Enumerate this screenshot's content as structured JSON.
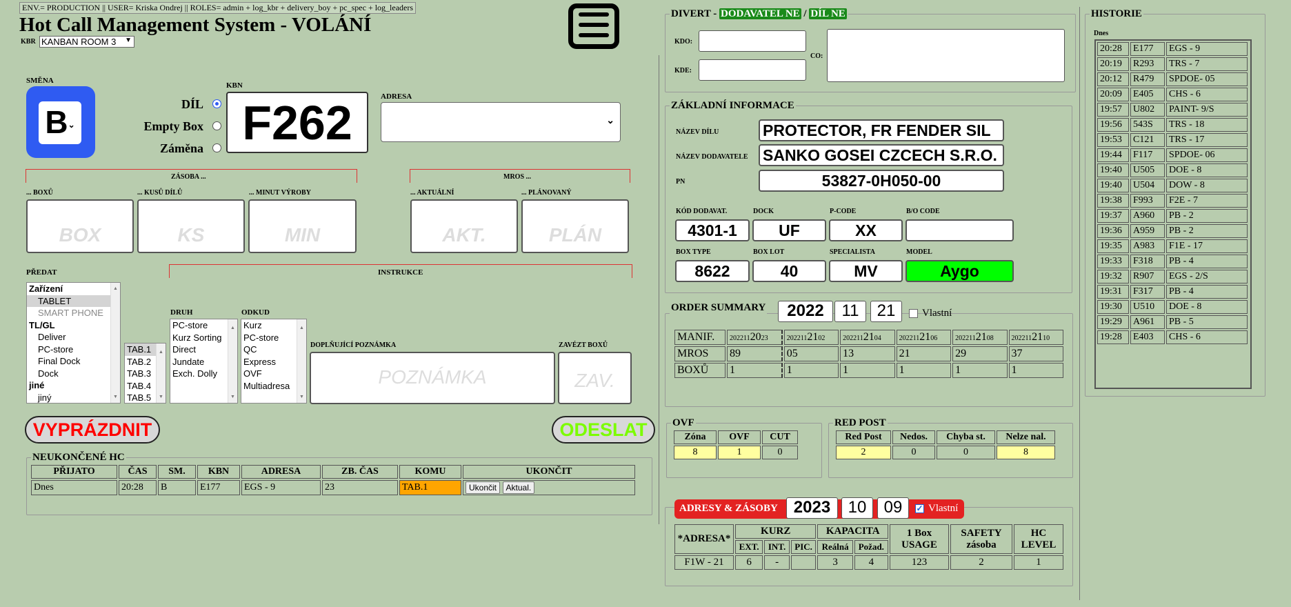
{
  "env_bar": "ENV.= PRODUCTION || USER= Kriska Ondrej || ROLES= admin + log_kbr + delivery_boy + pc_spec + log_leaders",
  "title": "Hot Call Management System - VOLÁNÍ",
  "kbr": {
    "label": "KBR",
    "selected": "KANBAN ROOM 3"
  },
  "smena": {
    "label": "SMĚNA",
    "value": "B"
  },
  "radio": {
    "dil": "DÍL",
    "empty_box": "Empty Box",
    "zamena": "Záměna"
  },
  "kbn": {
    "label": "KBN",
    "value": "F262"
  },
  "adresa": {
    "label": "ADRESA"
  },
  "zasoba": {
    "header": "ZÁSOBA ...",
    "box_lbl": "... BOXŮ",
    "ks_lbl": "... KUSŮ DÍLŮ",
    "min_lbl": "... MINUT VÝROBY",
    "box_ph": "BOX",
    "ks_ph": "KS",
    "min_ph": "MIN"
  },
  "mros": {
    "header": "MROS ...",
    "akt_lbl": "... AKTUÁLNÍ",
    "plan_lbl": "... PLÁNOVANÝ",
    "akt_ph": "AKT.",
    "plan_ph": "PLÁN"
  },
  "predat": {
    "label": "PŘEDAT",
    "items": [
      "Zařízení",
      "TABLET",
      "SMART PHONE",
      "TL/GL",
      "Deliver",
      "PC-store",
      "Final Dock",
      "Dock",
      "jiné",
      "jiný"
    ]
  },
  "tabs": [
    "TAB.1",
    "TAB.2",
    "TAB.3",
    "TAB.4",
    "TAB.5"
  ],
  "instrukce": "INSTRUKCE",
  "druh": {
    "label": "DRUH",
    "items": [
      "PC-store",
      "Kurz Sorting",
      "Direct",
      "Jundate",
      "Exch. Dolly"
    ]
  },
  "odkud": {
    "label": "ODKUD",
    "items": [
      "Kurz",
      "PC-store",
      "QC",
      "Express",
      "OVF",
      "Multiadresa"
    ]
  },
  "poznamka": {
    "label": "DOPLŇUJÍCÍ POZNÁMKA",
    "placeholder": "POZNÁMKA"
  },
  "zavezt": {
    "label": "ZAVÉZT BOXŮ",
    "placeholder": "ZAV."
  },
  "buttons": {
    "vyprazdnit": "VYPRÁZDNIT",
    "odeslat": "ODESLAT"
  },
  "neukoncene": {
    "legend": "NEUKONČENÉ HC",
    "headers": [
      "PŘIJATO",
      "ČAS",
      "SM.",
      "KBN",
      "ADRESA",
      "ZB. ČAS",
      "KOMU",
      "UKONČIT"
    ],
    "row": {
      "prijato": "Dnes",
      "cas": "20:28",
      "sm": "B",
      "kbn": "E177",
      "adresa": "EGS - 9",
      "zb_cas": "23",
      "komu": "TAB.1",
      "btn1": "Ukončit",
      "btn2": "Aktual."
    }
  },
  "divert": {
    "legend_prefix": "DIVERT - ",
    "dodavatel": "DODAVATEL NE",
    "slash": " / ",
    "dil": "DÍL NE",
    "kdo": "KDO:",
    "kde": "KDE:",
    "co": "CO:"
  },
  "zakladni": {
    "legend": "ZÁKLADNÍ INFORMACE",
    "nazev_dilu_lbl": "NÁZEV DÍLU",
    "nazev_dilu": "PROTECTOR, FR FENDER SIL",
    "nazev_dod_lbl": "NÁZEV DODAVATELE",
    "nazev_dod": "SANKO GOSEI CZCECH S.R.O.",
    "pn_lbl": "PN",
    "pn": "53827-0H050-00",
    "kod_lbl": "KÓD DODAVAT.",
    "kod": "4301-1",
    "dock_lbl": "DOCK",
    "dock": "UF",
    "pcode_lbl": "P-CODE",
    "pcode": "XX",
    "bo_lbl": "B/O CODE",
    "bo": "",
    "boxtype_lbl": "BOX TYPE",
    "boxtype": "8622",
    "boxlot_lbl": "BOX LOT",
    "boxlot": "40",
    "spec_lbl": "SPECIALISTA",
    "spec": "MV",
    "model_lbl": "MODEL",
    "model": "Aygo",
    "model_color": "#00ff00"
  },
  "order_summary": {
    "legend": "ORDER SUMMARY",
    "year": "2022",
    "month": "11",
    "day": "21",
    "vlastni": "Vlastní",
    "rows": [
      {
        "label": "MANIF.",
        "values": [
          "20221120 23",
          "20221121 02",
          "20221121 04",
          "20221121 06",
          "20221121 08",
          "20221121 10"
        ]
      },
      {
        "label": "MROS",
        "values": [
          "89",
          "05",
          "13",
          "21",
          "29",
          "37"
        ]
      },
      {
        "label": "BOXŮ",
        "values": [
          "1",
          "1",
          "1",
          "1",
          "1",
          "1"
        ]
      }
    ],
    "manif_big": [
      "20",
      "21",
      "21",
      "21",
      "21",
      "21"
    ],
    "manif_small_pre": [
      "202211",
      "202211",
      "202211",
      "202211",
      "202211",
      "202211"
    ],
    "manif_small_post": [
      "23",
      "02",
      "04",
      "06",
      "08",
      "10"
    ]
  },
  "ovf": {
    "legend": "OVF",
    "headers": [
      "Zóna",
      "OVF",
      "CUT"
    ],
    "values": [
      "8",
      "1",
      "0"
    ]
  },
  "red_post": {
    "legend": "RED POST",
    "headers": [
      "Red Post",
      "Nedos.",
      "Chyba st.",
      "Nelze nal."
    ],
    "values": [
      "2",
      "0",
      "0",
      "8"
    ]
  },
  "adresy": {
    "legend": "ADRESY & ZÁSOBY",
    "year": "2023",
    "month": "10",
    "day": "09",
    "vlastni": "Vlastní",
    "h_adresa": "*ADRESA*",
    "h_kurz": "KURZ",
    "h_kapacita": "KAPACITA",
    "h_usage": "1 Box USAGE",
    "h_safety": "SAFETY zásoba",
    "h_hc": "HC LEVEL",
    "sub": [
      "EXT.",
      "INT.",
      "PIC.",
      "Reálná",
      "Požad."
    ],
    "row": [
      "F1W - 21",
      "6",
      "-",
      "",
      "3",
      "4",
      "123",
      "2",
      "1"
    ]
  },
  "historie": {
    "legend": "HISTORIE",
    "day": "Dnes",
    "rows": [
      [
        "20:28",
        "E177",
        "EGS - 9"
      ],
      [
        "20:19",
        "R293",
        "TRS - 7"
      ],
      [
        "20:12",
        "R479",
        "SPDOE- 05"
      ],
      [
        "20:09",
        "E405",
        "CHS - 6"
      ],
      [
        "19:57",
        "U802",
        "PAINT- 9/S"
      ],
      [
        "19:56",
        "543S",
        "TRS - 18"
      ],
      [
        "19:53",
        "C121",
        "TRS - 17"
      ],
      [
        "19:44",
        "F117",
        "SPDOE- 06"
      ],
      [
        "19:40",
        "U505",
        "DOE - 8"
      ],
      [
        "19:40",
        "U504",
        "DOW - 8"
      ],
      [
        "19:38",
        "F993",
        "F2E - 7"
      ],
      [
        "19:37",
        "A960",
        "PB - 2"
      ],
      [
        "19:36",
        "A959",
        "PB - 2"
      ],
      [
        "19:35",
        "A983",
        "F1E - 17"
      ],
      [
        "19:33",
        "F318",
        "PB - 4"
      ],
      [
        "19:32",
        "R907",
        "EGS - 2/S"
      ],
      [
        "19:31",
        "F317",
        "PB - 4"
      ],
      [
        "19:30",
        "U510",
        "DOE - 8"
      ],
      [
        "19:29",
        "A961",
        "PB - 5"
      ],
      [
        "19:28",
        "E403",
        "CHS - 6"
      ]
    ]
  },
  "icons": {
    "menu": "hamburger-menu-icon",
    "chevron": "chevron-down-icon"
  }
}
